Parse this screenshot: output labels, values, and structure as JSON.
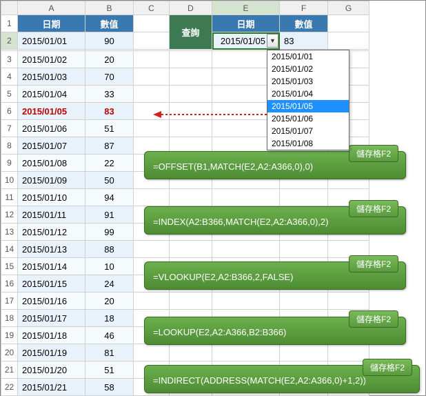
{
  "columns": [
    "A",
    "B",
    "C",
    "D",
    "E",
    "F",
    "G"
  ],
  "headers": {
    "date": "日期",
    "value": "數值",
    "query": "查詢"
  },
  "table": [
    {
      "r": 2,
      "date": "2015/01/01",
      "val": "90"
    },
    {
      "r": 3,
      "date": "2015/01/02",
      "val": "20"
    },
    {
      "r": 4,
      "date": "2015/01/03",
      "val": "70"
    },
    {
      "r": 5,
      "date": "2015/01/04",
      "val": "33"
    },
    {
      "r": 6,
      "date": "2015/01/05",
      "val": "83",
      "hl": true
    },
    {
      "r": 7,
      "date": "2015/01/06",
      "val": "51"
    },
    {
      "r": 8,
      "date": "2015/01/07",
      "val": "87"
    },
    {
      "r": 9,
      "date": "2015/01/08",
      "val": "22"
    },
    {
      "r": 10,
      "date": "2015/01/09",
      "val": "50"
    },
    {
      "r": 11,
      "date": "2015/01/10",
      "val": "94"
    },
    {
      "r": 12,
      "date": "2015/01/11",
      "val": "91"
    },
    {
      "r": 13,
      "date": "2015/01/12",
      "val": "99"
    },
    {
      "r": 14,
      "date": "2015/01/13",
      "val": "88"
    },
    {
      "r": 15,
      "date": "2015/01/14",
      "val": "10"
    },
    {
      "r": 16,
      "date": "2015/01/15",
      "val": "24"
    },
    {
      "r": 17,
      "date": "2015/01/16",
      "val": "20"
    },
    {
      "r": 18,
      "date": "2015/01/17",
      "val": "18"
    },
    {
      "r": 19,
      "date": "2015/01/18",
      "val": "46"
    },
    {
      "r": 20,
      "date": "2015/01/19",
      "val": "81"
    },
    {
      "r": 21,
      "date": "2015/01/20",
      "val": "51"
    },
    {
      "r": 22,
      "date": "2015/01/21",
      "val": "58"
    }
  ],
  "lookup": {
    "date": "2015/01/05",
    "value": "83"
  },
  "dropdown": {
    "options": [
      "2015/01/01",
      "2015/01/02",
      "2015/01/03",
      "2015/01/04",
      "2015/01/05",
      "2015/01/06",
      "2015/01/07",
      "2015/01/08"
    ],
    "selected": "2015/01/05"
  },
  "arrow_icon": "◄",
  "callouts": [
    {
      "badge": "儲存格F2",
      "formula": "=OFFSET(B1,MATCH(E2,A2:A366,0),0)"
    },
    {
      "badge": "儲存格F2",
      "formula": "=INDEX(A2:B366,MATCH(E2,A2:A366,0),2)"
    },
    {
      "badge": "儲存格F2",
      "formula": "=VLOOKUP(E2,A2:B366,2,FALSE)"
    },
    {
      "badge": "儲存格F2",
      "formula": "=LOOKUP(E2,A2:A366,B2:B366)"
    },
    {
      "badge": "儲存格F2",
      "formula": "=INDIRECT(ADDRESS(MATCH(E2,A2:A366,0)+1,2))"
    }
  ]
}
